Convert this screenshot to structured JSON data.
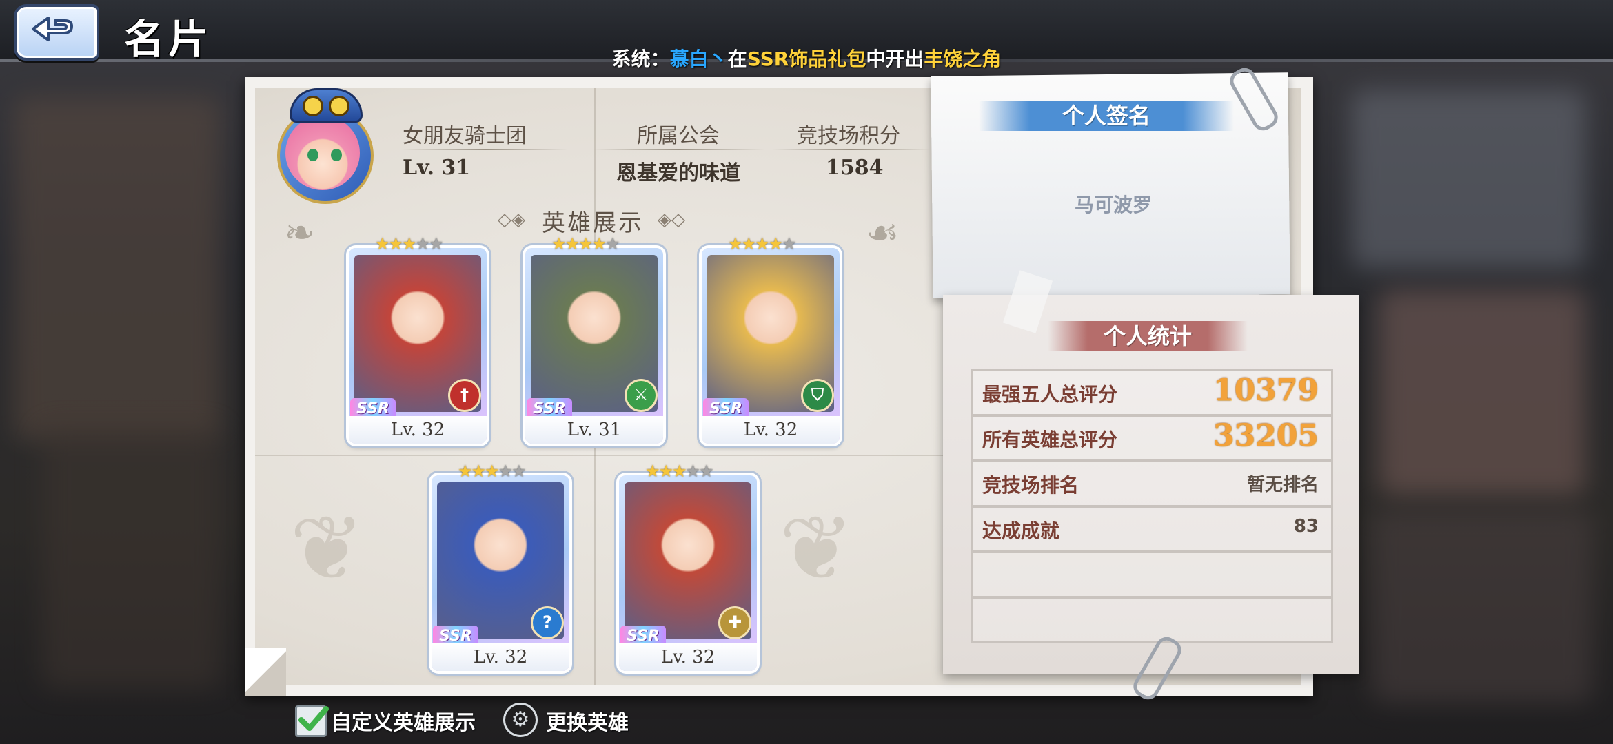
{
  "header": {
    "title": "名片",
    "system_message": {
      "prefix": "系统：",
      "player": "慕白丶",
      "mid1": "在",
      "item_source": "SSR饰品礼包",
      "mid2": "中开出",
      "item": "丰饶之角"
    }
  },
  "profile": {
    "name": "女朋友骑士团",
    "level": "Lv. 31",
    "guild_label": "所属公会",
    "guild_value": "恩基爱的味道",
    "arena_label": "竞技场积分",
    "arena_value": "1584"
  },
  "hero_showcase": {
    "title": "英雄展示",
    "heroes": [
      {
        "level": "Lv. 32",
        "rarity": "SSR",
        "stars": 3,
        "class_icon": "sword-icon",
        "colors": {
          "art": "#c2453b",
          "cls": "#c0302c"
        }
      },
      {
        "level": "Lv. 31",
        "rarity": "SSR",
        "stars": 4,
        "class_icon": "crossed-swords-icon",
        "colors": {
          "art": "#6a7a55",
          "cls": "#3a9e4a"
        }
      },
      {
        "level": "Lv. 32",
        "rarity": "SSR",
        "stars": 4,
        "class_icon": "shield-icon",
        "colors": {
          "art": "#e6b950",
          "cls": "#2d8a47"
        }
      },
      {
        "level": "Lv. 32",
        "rarity": "SSR",
        "stars": 3,
        "class_icon": "question-icon",
        "colors": {
          "art": "#3c5cb8",
          "cls": "#2a7bd0"
        }
      },
      {
        "level": "Lv. 32",
        "rarity": "SSR",
        "stars": 3,
        "class_icon": "cross-icon",
        "colors": {
          "art": "#c04a3a",
          "cls": "#b8953a"
        }
      }
    ]
  },
  "signature": {
    "title": "个人签名",
    "text": "马可波罗"
  },
  "stats": {
    "title": "个人统计",
    "rows": [
      {
        "label": "最强五人总评分",
        "value": "10379"
      },
      {
        "label": "所有英雄总评分",
        "value": "33205"
      },
      {
        "label": "竞技场排名",
        "value": "暂无排名"
      },
      {
        "label": "达成成就",
        "value": "83"
      },
      {
        "label": "",
        "value": ""
      },
      {
        "label": "",
        "value": ""
      }
    ]
  },
  "actions": {
    "custom_showcase": "自定义英雄展示",
    "custom_showcase_checked": true,
    "change_hero": "更换英雄"
  }
}
